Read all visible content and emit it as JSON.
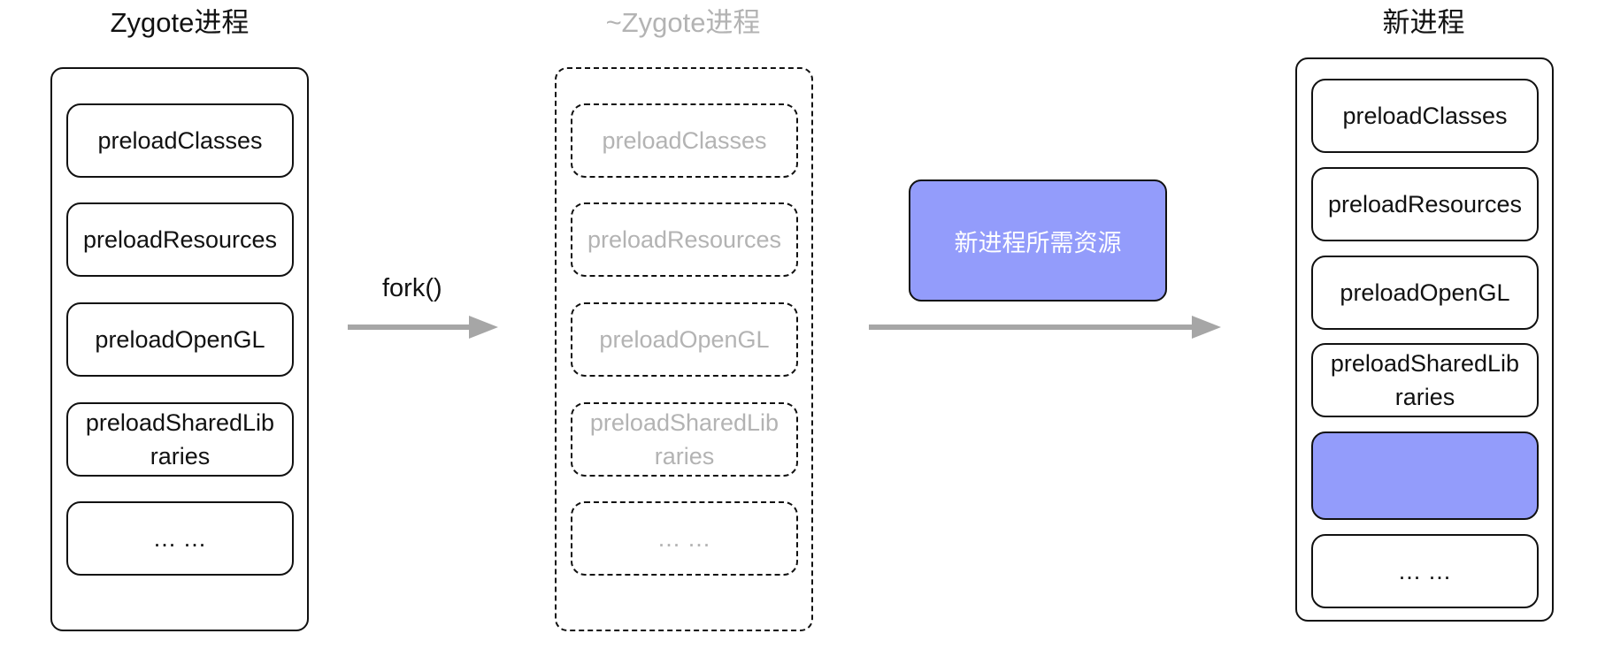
{
  "columns": {
    "zygote": {
      "title": "Zygote进程",
      "items": [
        "preloadClasses",
        "preloadResources",
        "preloadOpenGL",
        "preloadSharedLib\nraries",
        "... ..."
      ]
    },
    "forked": {
      "title": "~Zygote进程",
      "items": [
        "preloadClasses",
        "preloadResources",
        "preloadOpenGL",
        "preloadSharedLib\nraries",
        "... ..."
      ]
    },
    "new_process": {
      "title": "新进程",
      "items": [
        "preloadClasses",
        "preloadResources",
        "preloadOpenGL",
        "preloadSharedLib\nraries",
        "",
        "... ..."
      ]
    }
  },
  "fork_label": "fork()",
  "resource_box_label": "新进程所需资源",
  "colors": {
    "highlight": "#939cfb",
    "arrow": "#a6a6a6",
    "faded_text": "#b3b3b3"
  }
}
